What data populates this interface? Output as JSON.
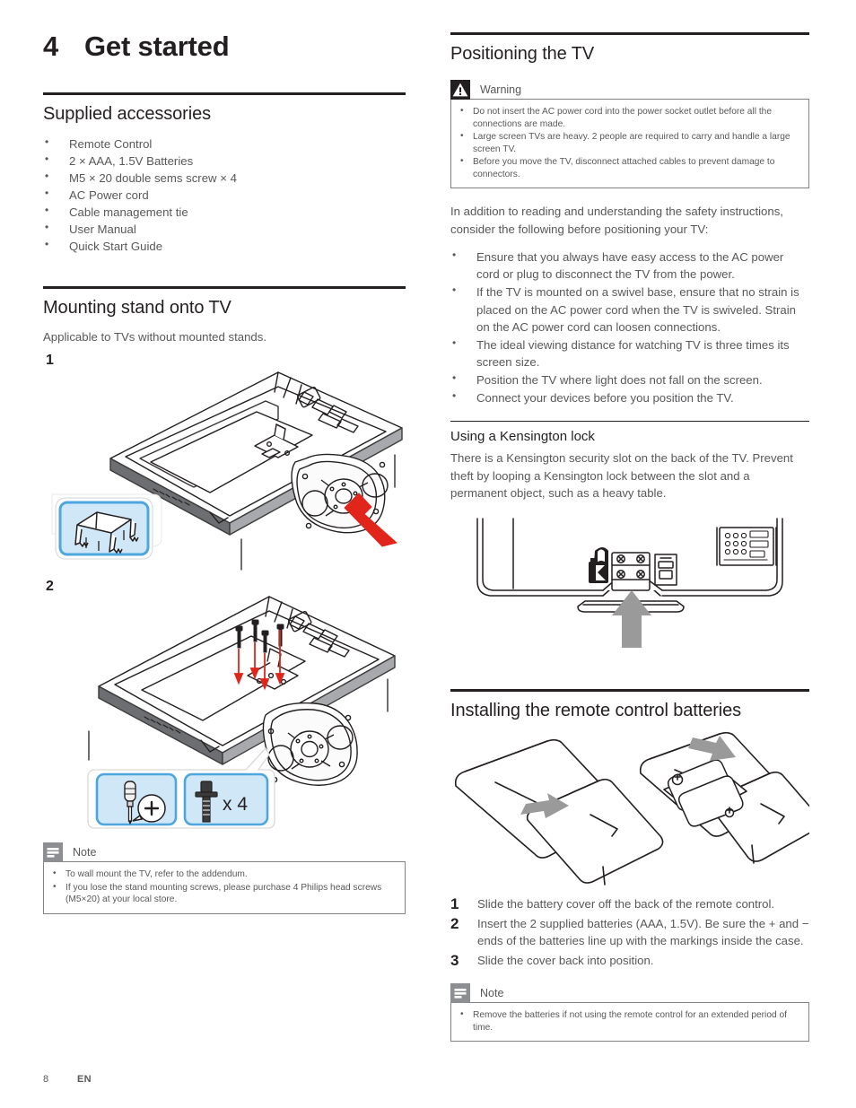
{
  "chapter": {
    "number": "4",
    "title": "Get started"
  },
  "left": {
    "supplied": {
      "heading": "Supplied accessories",
      "items": [
        "Remote Control",
        "2 × AAA, 1.5V Batteries",
        "M5 × 20 double sems screw × 4",
        "AC Power cord",
        "Cable management tie",
        "User Manual",
        "Quick Start Guide"
      ]
    },
    "mounting": {
      "heading": "Mounting stand onto TV",
      "intro": "Applicable to TVs without mounted stands.",
      "step1_num": "1",
      "step2_num": "2",
      "screw_count_label": "x 4"
    },
    "note": {
      "label": "Note",
      "icon": "note-icon",
      "items": [
        "To wall mount the TV, refer to the addendum.",
        "If you lose the stand mounting screws, please purchase 4 Philips head screws (M5×20) at your local store."
      ]
    }
  },
  "right": {
    "positioning": {
      "heading": "Positioning the TV"
    },
    "warning": {
      "label": "Warning",
      "icon": "warning-icon",
      "items": [
        "Do not insert the AC power cord into the power socket outlet before all the connections are made.",
        "Large screen TVs are heavy. 2 people are required to carry and handle a large screen TV.",
        "Before you move the TV, disconnect attached cables to prevent damage to connectors."
      ]
    },
    "intro": "In addition to reading and understanding the safety instructions, consider the following before positioning your TV:",
    "bullets": [
      "Ensure that you always have easy access to the AC power cord or plug to disconnect the TV from the power.",
      "If the TV is mounted on a swivel base, ensure that no strain is placed on the AC power cord when the TV is swiveled. Strain on the AC power cord can loosen connections.",
      "The ideal viewing distance for watching TV is three times its screen size.",
      "Position the TV where light does not fall on the screen.",
      "Connect your devices before you position the TV."
    ],
    "kensington": {
      "heading": "Using a Kensington lock",
      "text": "There is a Kensington security slot on the back of the TV. Prevent theft by looping a Kensington lock between the slot and a permanent object, such as a heavy table."
    },
    "batteries": {
      "heading": "Installing the remote control batteries",
      "steps": [
        {
          "num": "1",
          "text": "Slide the battery cover off the back of the remote control."
        },
        {
          "num": "2",
          "text": "Insert the 2 supplied batteries (AAA, 1.5V). Be sure the + and − ends of the batteries line up with the markings inside the case."
        },
        {
          "num": "3",
          "text": "Slide the cover back into position."
        }
      ]
    },
    "note": {
      "label": "Note",
      "icon": "note-icon",
      "items": [
        "Remove the batteries if not using the remote control for an extended period of time."
      ]
    }
  },
  "footer": {
    "page_number": "8",
    "language": "EN"
  },
  "colors": {
    "ink": "#231f20",
    "body_text": "#58585a",
    "rule": "#231f20",
    "inset_fill": "#cfe7f7",
    "inset_border": "#4da6dd",
    "arrow_red": "#e1251b",
    "arrow_gray": "#9a9a9a",
    "note_icon_bg": "#8d8e91",
    "warning_icon_bg": "#231f20"
  }
}
